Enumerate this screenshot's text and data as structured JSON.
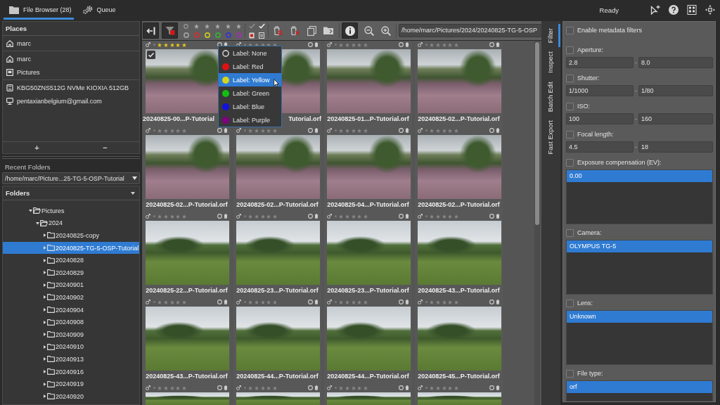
{
  "tabs": [
    {
      "label": "File Browser (28)",
      "selected": true,
      "kind": "folder"
    },
    {
      "label": "Queue",
      "selected": false,
      "kind": "gears"
    }
  ],
  "status": "Ready",
  "places": {
    "title": "Places",
    "groups": [
      {
        "items": [
          {
            "label": "marc",
            "kind": "home"
          }
        ]
      },
      {
        "items": [
          {
            "label": "marc",
            "kind": "home"
          },
          {
            "label": "Pictures",
            "kind": "pictures"
          }
        ]
      },
      {
        "items": [
          {
            "label": "KBG50ZNS512G NVMe KIOXIA 512GB",
            "kind": "drive"
          },
          {
            "label": "pentaxianbelgium@gmail.com",
            "kind": "network"
          }
        ]
      }
    ],
    "add_button": "+",
    "remove_button": "−"
  },
  "recent_folders": {
    "label": "Recent Folders",
    "value": "/home/marc/Picture...25-TG-5-OSP-Tutorial"
  },
  "folders": {
    "title": "Folders",
    "tree": [
      {
        "label": "Pictures",
        "expanded": true,
        "selected": false,
        "children": [
          {
            "label": "2024",
            "expanded": true,
            "selected": false,
            "children": [
              {
                "label": "20240825-copy",
                "expanded": false,
                "selected": false
              },
              {
                "label": "20240825-TG-5-OSP-Tutorial",
                "expanded": false,
                "selected": true
              },
              {
                "label": "20240828",
                "expanded": false,
                "selected": false
              },
              {
                "label": "20240829",
                "expanded": false,
                "selected": false
              },
              {
                "label": "20240901",
                "expanded": false,
                "selected": false
              },
              {
                "label": "20240902",
                "expanded": false,
                "selected": false
              },
              {
                "label": "20240904",
                "expanded": false,
                "selected": false
              },
              {
                "label": "20240908",
                "expanded": false,
                "selected": false
              },
              {
                "label": "20240909",
                "expanded": false,
                "selected": false
              },
              {
                "label": "20240910",
                "expanded": false,
                "selected": false
              },
              {
                "label": "20240913",
                "expanded": false,
                "selected": false
              },
              {
                "label": "20240916",
                "expanded": false,
                "selected": false
              },
              {
                "label": "20240919",
                "expanded": false,
                "selected": false
              },
              {
                "label": "20240920",
                "expanded": false,
                "selected": false
              }
            ]
          }
        ]
      }
    ]
  },
  "toolbar": {
    "panel_buttons": [
      {
        "kind": "panel",
        "on": true
      },
      {
        "kind": "filter",
        "on": true
      }
    ],
    "label_filters": [
      {
        "color": "#a2a2a2"
      },
      {
        "color": "#d23030"
      },
      {
        "color": "#c9c925"
      },
      {
        "color": "#35b035"
      },
      {
        "color": "#3535d0"
      },
      {
        "color": "#9a35a8"
      }
    ],
    "file_buttons": [
      {
        "kind": "trash-search",
        "on": false
      },
      {
        "kind": "trash-remove",
        "on": false
      },
      {
        "kind": "copy",
        "on": false
      },
      {
        "kind": "folder",
        "on": false
      }
    ],
    "view_buttons": [
      {
        "kind": "info",
        "on": true
      },
      {
        "kind": "zoom-out",
        "on": false
      },
      {
        "kind": "zoom-in",
        "on": false
      }
    ],
    "path": "/home/marc/Pictures/2024/20240825-TG-5-OSP"
  },
  "thumbnails": [
    {
      "name_head": "20240825-00...P-Tutorial",
      "stars": 5,
      "checked": true,
      "kind": "heath"
    },
    {
      "name_tail": "Tutorial.orf",
      "stars": 0,
      "checked": false,
      "kind": "heath"
    },
    {
      "name": "20240825-01...P-Tutorial.orf",
      "stars": 0,
      "checked": false,
      "kind": "heath"
    },
    {
      "name": "20240825-02...P-Tutorial.orf",
      "stars": 0,
      "checked": false,
      "kind": "heath"
    },
    {
      "name": "20240825-02...P-Tutorial.orf",
      "stars": 0,
      "checked": false,
      "kind": "heath"
    },
    {
      "name": "20240825-02...P-Tutorial.orf",
      "stars": 0,
      "checked": false,
      "kind": "heath"
    },
    {
      "name": "20240825-04...P-Tutorial.orf",
      "stars": 0,
      "checked": false,
      "kind": "heath"
    },
    {
      "name": "20240825-02...P-Tutorial.orf",
      "stars": 0,
      "checked": false,
      "kind": "heath"
    },
    {
      "name": "20240825-22...P-Tutorial.orf",
      "stars": 0,
      "checked": false,
      "kind": "field"
    },
    {
      "name": "20240825-23...P-Tutorial.orf",
      "stars": 0,
      "checked": false,
      "kind": "field"
    },
    {
      "name": "20240825-23...P-Tutorial.orf",
      "stars": 0,
      "checked": false,
      "kind": "field"
    },
    {
      "name": "20240825-43...P-Tutorial.orf",
      "stars": 0,
      "checked": false,
      "kind": "field"
    },
    {
      "name": "20240825-43...P-Tutorial.orf",
      "stars": 0,
      "checked": false,
      "kind": "field"
    },
    {
      "name": "20240825-44...P-Tutorial.orf",
      "stars": 0,
      "checked": false,
      "kind": "field"
    },
    {
      "name": "20240825-44...P-Tutorial.orf",
      "stars": 0,
      "checked": false,
      "kind": "field"
    },
    {
      "name": "20240825-45...P-Tutorial.orf",
      "stars": 0,
      "checked": false,
      "kind": "field"
    },
    {
      "stars": 0,
      "checked": false,
      "kind": "field"
    },
    {
      "stars": 0,
      "checked": false,
      "kind": "field"
    },
    {
      "stars": 0,
      "checked": false,
      "kind": "field"
    },
    {
      "stars": 0,
      "checked": false,
      "kind": "field"
    }
  ],
  "label_menu": {
    "items": [
      {
        "label": "Label: None",
        "selected": false
      },
      {
        "label": "Label: Red",
        "color": "#e01212",
        "selected": false
      },
      {
        "label": "Label: Yellow",
        "color": "#d4d41e",
        "selected": true
      },
      {
        "label": "Label: Green",
        "color": "#12c012",
        "selected": false
      },
      {
        "label": "Label: Blue",
        "color": "#1212e0",
        "selected": false
      },
      {
        "label": "Label: Purple",
        "color": "#800080",
        "selected": false
      }
    ]
  },
  "side_tabs": [
    {
      "label": "Filter",
      "selected": true
    },
    {
      "label": "Inspect",
      "selected": false
    },
    {
      "label": "Batch Edit",
      "selected": false
    },
    {
      "label": "Fast Export",
      "selected": false
    }
  ],
  "filters": {
    "enable": {
      "label": "Enable metadata filters",
      "checked": false
    },
    "ranges": [
      {
        "label": "Aperture:",
        "checked": false,
        "from": "2.8",
        "separator": "-",
        "to": "8.0"
      },
      {
        "label": "Shutter:",
        "checked": false,
        "from": "1/1000",
        "separator": "-",
        "to": "1/80"
      },
      {
        "label": "ISO:",
        "checked": false,
        "from": "100",
        "separator": "-",
        "to": "160"
      },
      {
        "label": "Focal length:",
        "checked": false,
        "from": "4.5",
        "separator": "-",
        "to": "18"
      }
    ],
    "lists": [
      {
        "label": "Exposure compensation (EV):",
        "checked": false,
        "items": [
          {
            "label": "0.00",
            "selected": true
          }
        ]
      },
      {
        "label": "Camera:",
        "checked": false,
        "items": [
          {
            "label": "OLYMPUS TG-5",
            "selected": true
          }
        ]
      },
      {
        "label": "Lens:",
        "checked": false,
        "items": [
          {
            "label": "Unknown",
            "selected": true
          }
        ]
      },
      {
        "label": "File type:",
        "checked": false,
        "items": [
          {
            "label": "orf",
            "selected": true
          }
        ]
      }
    ]
  }
}
